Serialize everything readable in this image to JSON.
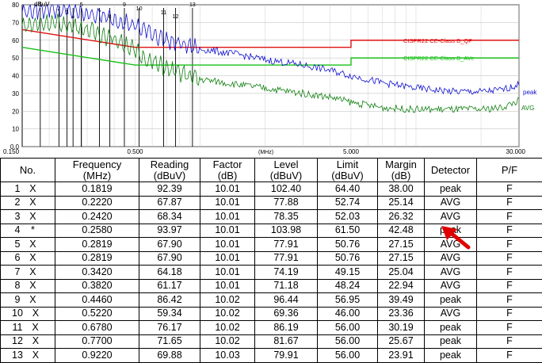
{
  "chart_data": {
    "type": "line",
    "x_scale": "log",
    "xlim": [
      0.15,
      30.0
    ],
    "ylim": [
      0.0,
      80.0
    ],
    "xlabel": "(MHz)",
    "ylabel": "dBuV",
    "x_tick_labels": [
      "0.150",
      "0.500",
      "5.000",
      "30.000"
    ],
    "x_ticks": [
      0.15,
      0.5,
      5.0,
      30.0
    ],
    "y_ticks": [
      0,
      10,
      20,
      30,
      40,
      50,
      60,
      70,
      80
    ],
    "y_tick_labels": [
      "0.0",
      "10",
      "20",
      "30",
      "40",
      "50",
      "60",
      "70",
      "80"
    ],
    "grid": true,
    "series": [
      {
        "name": "CISPR22 CE-Class B_QP",
        "color": "#e01010",
        "type": "limit",
        "x": [
          0.15,
          0.5,
          0.5,
          5.0,
          5.0,
          30.0
        ],
        "y": [
          66.0,
          56.0,
          56.0,
          56.0,
          60.0,
          60.0
        ]
      },
      {
        "name": "CISPR22 CE-Class B_AVe",
        "color": "#18c018",
        "type": "limit",
        "x": [
          0.15,
          0.5,
          0.5,
          5.0,
          5.0,
          30.0
        ],
        "y": [
          56.0,
          46.0,
          46.0,
          46.0,
          50.0,
          50.0
        ]
      },
      {
        "name": "peak",
        "color": "#1010d0",
        "type": "trace",
        "x": [
          0.15,
          0.2,
          0.26,
          0.34,
          0.45,
          0.55,
          0.7,
          1.0,
          1.5,
          2.0,
          3.0,
          4.0,
          5.0,
          7.0,
          10.0,
          15.0,
          20.0,
          25.0,
          30.0
        ],
        "y": [
          76.0,
          78.0,
          76.0,
          74.0,
          70.0,
          66.0,
          60.0,
          55.0,
          52.0,
          49.0,
          46.0,
          43.0,
          40.0,
          36.0,
          33.0,
          31.0,
          31.0,
          32.0,
          35.0
        ]
      },
      {
        "name": "AVG",
        "color": "#108010",
        "type": "trace",
        "x": [
          0.15,
          0.2,
          0.26,
          0.34,
          0.45,
          0.55,
          0.7,
          1.0,
          1.5,
          2.0,
          3.0,
          4.0,
          5.0,
          7.0,
          10.0,
          15.0,
          20.0,
          25.0,
          30.0
        ],
        "y": [
          68.0,
          70.0,
          68.0,
          64.0,
          58.0,
          50.0,
          44.0,
          38.0,
          35.0,
          33.0,
          30.0,
          28.0,
          25.0,
          22.0,
          21.0,
          21.0,
          21.0,
          22.0,
          26.0
        ]
      }
    ],
    "markers": [
      {
        "label": "1",
        "freq": 0.1819
      },
      {
        "label": "2",
        "freq": 0.222
      },
      {
        "label": "3",
        "freq": 0.242
      },
      {
        "label": "4",
        "freq": 0.258
      },
      {
        "label": "5",
        "freq": 0.2819
      },
      {
        "label": "6",
        "freq": 0.2819
      },
      {
        "label": "7",
        "freq": 0.342
      },
      {
        "label": "8",
        "freq": 0.382
      },
      {
        "label": "9",
        "freq": 0.446
      },
      {
        "label": "10",
        "freq": 0.522
      },
      {
        "label": "11",
        "freq": 0.678
      },
      {
        "label": "12",
        "freq": 0.77
      },
      {
        "label": "13",
        "freq": 0.922
      }
    ]
  },
  "chart_labels": {
    "qp_limit": "CISPR22 CE-Class B_QP",
    "avg_limit": "CISPR22 CE-Class B_AVe",
    "peak_trace": "peak",
    "avg_trace": "AVG"
  },
  "table": {
    "headers": {
      "no": "No.",
      "frequency": [
        "Frequency",
        "(MHz)"
      ],
      "reading": [
        "Reading",
        "(dBuV)"
      ],
      "factor": [
        "Factor",
        "(dB)"
      ],
      "level": [
        "Level",
        "(dBuV)"
      ],
      "limit": [
        "Limit",
        "(dBuV)"
      ],
      "margin": [
        "Margin",
        "(dB)"
      ],
      "detector": "Detector",
      "pf": "P/F"
    },
    "rows": [
      {
        "no": "1",
        "mark": "X",
        "frequency": "0.1819",
        "reading": "92.39",
        "factor": "10.01",
        "level": "102.40",
        "limit": "64.40",
        "margin": "38.00",
        "detector": "peak",
        "pf": "F"
      },
      {
        "no": "2",
        "mark": "X",
        "frequency": "0.2220",
        "reading": "67.87",
        "factor": "10.01",
        "level": "77.88",
        "limit": "52.74",
        "margin": "25.14",
        "detector": "AVG",
        "pf": "F"
      },
      {
        "no": "3",
        "mark": "X",
        "frequency": "0.2420",
        "reading": "68.34",
        "factor": "10.01",
        "level": "78.35",
        "limit": "52.03",
        "margin": "26.32",
        "detector": "AVG",
        "pf": "F"
      },
      {
        "no": "4",
        "mark": "*",
        "frequency": "0.2580",
        "reading": "93.97",
        "factor": "10.01",
        "level": "103.98",
        "limit": "61.50",
        "margin": "42.48",
        "detector": "peak",
        "pf": "F"
      },
      {
        "no": "5",
        "mark": "X",
        "frequency": "0.2819",
        "reading": "67.90",
        "factor": "10.01",
        "level": "77.91",
        "limit": "50.76",
        "margin": "27.15",
        "detector": "AVG",
        "pf": "F"
      },
      {
        "no": "6",
        "mark": "X",
        "frequency": "0.2819",
        "reading": "67.90",
        "factor": "10.01",
        "level": "77.91",
        "limit": "50.76",
        "margin": "27.15",
        "detector": "AVG",
        "pf": "F"
      },
      {
        "no": "7",
        "mark": "X",
        "frequency": "0.3420",
        "reading": "64.18",
        "factor": "10.01",
        "level": "74.19",
        "limit": "49.15",
        "margin": "25.04",
        "detector": "AVG",
        "pf": "F"
      },
      {
        "no": "8",
        "mark": "X",
        "frequency": "0.3820",
        "reading": "61.17",
        "factor": "10.01",
        "level": "71.18",
        "limit": "48.24",
        "margin": "22.94",
        "detector": "AVG",
        "pf": "F"
      },
      {
        "no": "9",
        "mark": "X",
        "frequency": "0.4460",
        "reading": "86.42",
        "factor": "10.02",
        "level": "96.44",
        "limit": "56.95",
        "margin": "39.49",
        "detector": "peak",
        "pf": "F"
      },
      {
        "no": "10",
        "mark": "X",
        "frequency": "0.5220",
        "reading": "59.34",
        "factor": "10.02",
        "level": "69.36",
        "limit": "46.00",
        "margin": "23.36",
        "detector": "AVG",
        "pf": "F"
      },
      {
        "no": "11",
        "mark": "X",
        "frequency": "0.6780",
        "reading": "76.17",
        "factor": "10.02",
        "level": "86.19",
        "limit": "56.00",
        "margin": "30.19",
        "detector": "peak",
        "pf": "F"
      },
      {
        "no": "12",
        "mark": "X",
        "frequency": "0.7700",
        "reading": "71.65",
        "factor": "10.02",
        "level": "81.67",
        "limit": "56.00",
        "margin": "25.67",
        "detector": "peak",
        "pf": "F"
      },
      {
        "no": "13",
        "mark": "X",
        "frequency": "0.9220",
        "reading": "69.88",
        "factor": "10.03",
        "level": "79.91",
        "limit": "56.00",
        "margin": "23.91",
        "detector": "peak",
        "pf": "F"
      }
    ]
  },
  "colors": {
    "qp_limit": "#e01010",
    "avg_limit": "#18c018",
    "peak": "#1010d0",
    "avg": "#108010",
    "arrow": "#e00000"
  }
}
